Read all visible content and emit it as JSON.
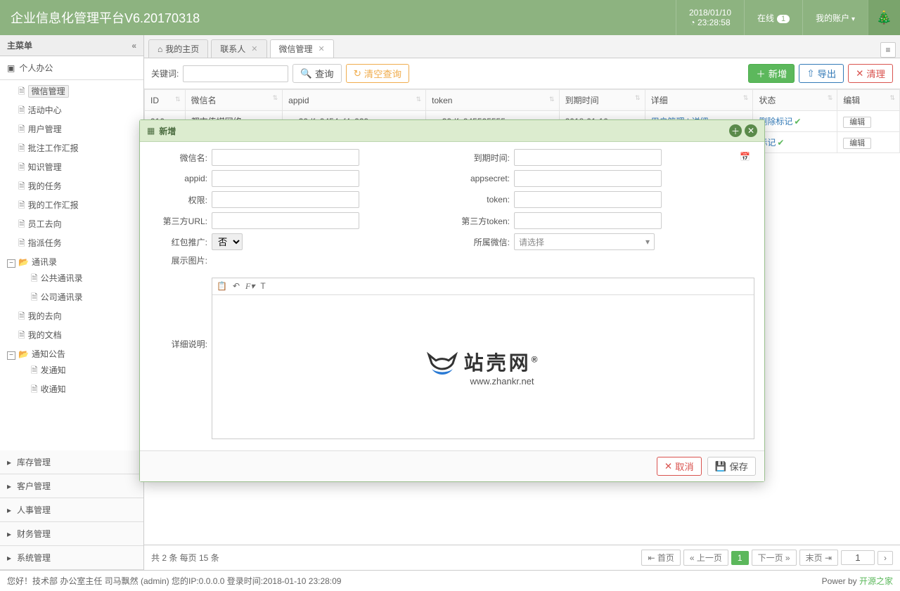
{
  "header": {
    "title": "企业信息化管理平台V6.20170318",
    "date": "2018/01/10",
    "time": "23:28:58",
    "online_label": "在线",
    "online_count": "1",
    "account_label": "我的账户"
  },
  "sidebar": {
    "title": "主菜单",
    "sections": [
      {
        "label": "个人办公",
        "open": true
      },
      {
        "label": "库存管理"
      },
      {
        "label": "客户管理"
      },
      {
        "label": "人事管理"
      },
      {
        "label": "财务管理"
      },
      {
        "label": "系统管理"
      }
    ],
    "tree": [
      {
        "label": "微信管理",
        "selected": true
      },
      {
        "label": "活动中心"
      },
      {
        "label": "用户管理"
      },
      {
        "label": "批注工作汇报"
      },
      {
        "label": "知识管理"
      },
      {
        "label": "我的任务"
      },
      {
        "label": "我的工作汇报"
      },
      {
        "label": "员工去向"
      },
      {
        "label": "指派任务"
      },
      {
        "label": "通讯录",
        "folder": true,
        "open": true,
        "children": [
          {
            "label": "公共通讯录"
          },
          {
            "label": "公司通讯录"
          }
        ]
      },
      {
        "label": "我的去向"
      },
      {
        "label": "我的文档"
      },
      {
        "label": "通知公告",
        "folder": true,
        "open": true,
        "children": [
          {
            "label": "发通知"
          },
          {
            "label": "收通知"
          }
        ]
      }
    ]
  },
  "tabs": {
    "items": [
      {
        "label": "我的主页",
        "home": true
      },
      {
        "label": "联系人",
        "closable": true
      },
      {
        "label": "微信管理",
        "closable": true,
        "active": true
      }
    ]
  },
  "toolbar": {
    "keyword_label": "关键词:",
    "search": "查询",
    "clear_search": "清空查询",
    "add": "新增",
    "export": "导出",
    "cleanup": "清理"
  },
  "grid": {
    "columns": [
      "ID",
      "微信名",
      "appid",
      "token",
      "到期时间",
      "详细",
      "状态",
      "编辑"
    ],
    "rows": [
      {
        "id": "910",
        "name": "都市传媒网络",
        "appid": "wx39dfe9454af4c929",
        "token": "wx39dfe945525555",
        "expire": "2018-01-10",
        "detail": "用户管理 | 详细",
        "status": "删除标记",
        "edit": "编辑"
      },
      {
        "id": "",
        "name": "",
        "appid": "",
        "token": "",
        "expire": "",
        "detail": "",
        "status": "标记",
        "edit": "编辑"
      }
    ]
  },
  "pager": {
    "summary": "共 2 条 每页 15 条",
    "first": "首页",
    "prev": "上一页",
    "current": "1",
    "next": "下一页",
    "last": "末页",
    "goto": "1"
  },
  "footer": {
    "greeting": "您好！技术部 办公室主任 司马飘然 (admin) 您的IP:0.0.0.0 登录时间:2018-01-10 23:28:09",
    "power": "Power by",
    "power_link": "开源之家"
  },
  "modal": {
    "title": "新增",
    "labels": {
      "wxname": "微信名:",
      "expire": "到期时间:",
      "appid": "appid:",
      "appsecret": "appsecret:",
      "perm": "权限:",
      "token": "token:",
      "url3": "第三方URL:",
      "token3": "第三方token:",
      "hongbao": "红包推广:",
      "belong": "所属微信:",
      "img": "展示图片:",
      "desc": "详细说明:"
    },
    "hongbao_value": "否",
    "belong_placeholder": "请选择",
    "cancel": "取消",
    "save": "保存",
    "watermark_text": "站壳网",
    "watermark_url": "www.zhankr.net"
  }
}
